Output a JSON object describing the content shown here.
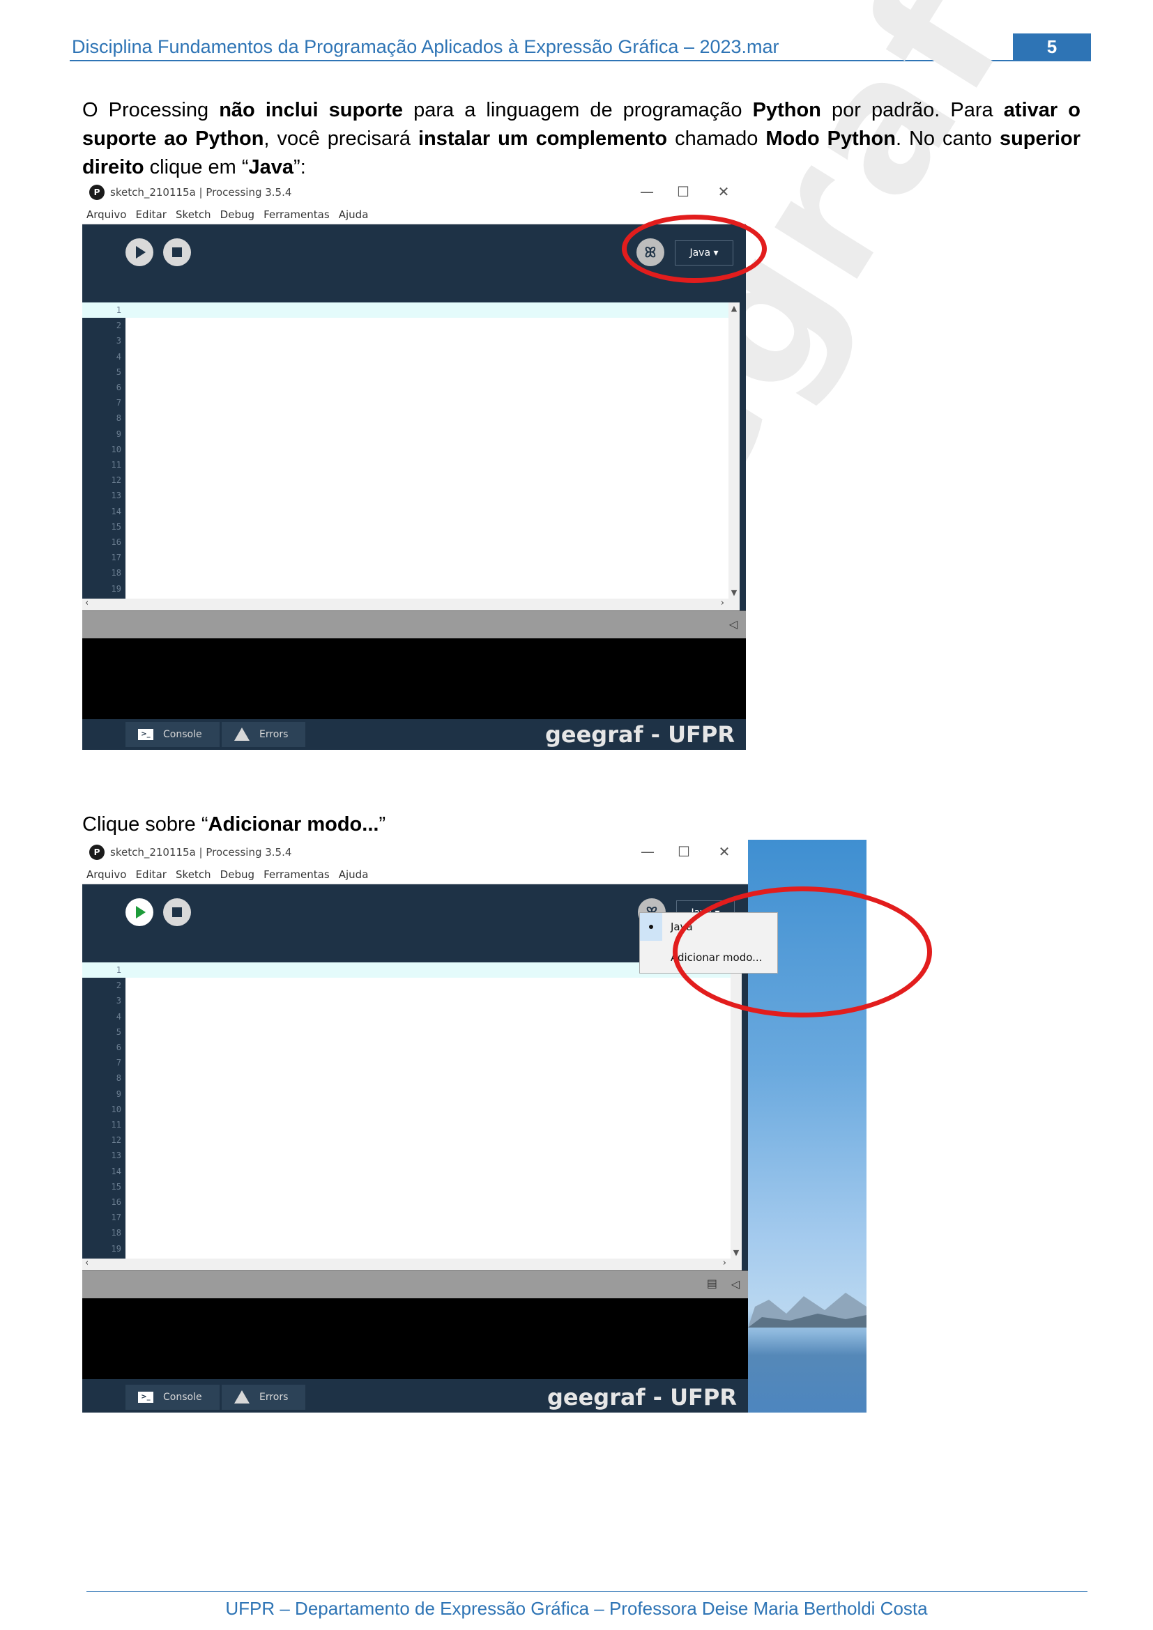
{
  "header": {
    "title": "Disciplina Fundamentos da Programação Aplicados à Expressão Gráfica – 2023.mar",
    "page_number": "5"
  },
  "watermark": "geegraf - UFPR",
  "paragraph1": {
    "t1": "O Processing ",
    "b1": "não inclui suporte",
    "t2": " para a linguagem de programação ",
    "b2": "Python",
    "t3": " por padrão. Para ",
    "b3": "ativar o suporte ao Python",
    "t4": ", você precisará ",
    "b4": "instalar um complemento",
    "t5": " chamado ",
    "b5": "Modo Python",
    "t6": ". No canto ",
    "b6": "superior direito",
    "t7": " clique em “",
    "b7": "Java",
    "t8": "”:"
  },
  "paragraph2": {
    "t1": "Clique sobre “",
    "b1": "Adicionar modo...",
    "t2": "”"
  },
  "window": {
    "title": "sketch_210115a | Processing 3.5.4",
    "menu": [
      "Arquivo",
      "Editar",
      "Sketch",
      "Debug",
      "Ferramentas",
      "Ajuda"
    ],
    "mode": "Java ▾",
    "tab": "sketch_210115a",
    "line_numbers": [
      "1",
      "2",
      "3",
      "4",
      "5",
      "6",
      "7",
      "8",
      "9",
      "10",
      "11",
      "12",
      "13",
      "14",
      "15",
      "16",
      "17",
      "18",
      "19"
    ],
    "console_tab": "Console",
    "errors_tab": "Errors",
    "brand": "geegraf - UFPR",
    "minimize": "—",
    "maximize": "☐",
    "close": "✕"
  },
  "dropdown": {
    "items": [
      "Java",
      "Adicionar modo..."
    ]
  },
  "footer": "UFPR – Departamento de Expressão Gráfica – Professora Deise Maria Bertholdi Costa",
  "colors": {
    "accent": "#2e74b5",
    "editor_bg": "#1e3246",
    "highlight_ring": "#e21d1d"
  }
}
